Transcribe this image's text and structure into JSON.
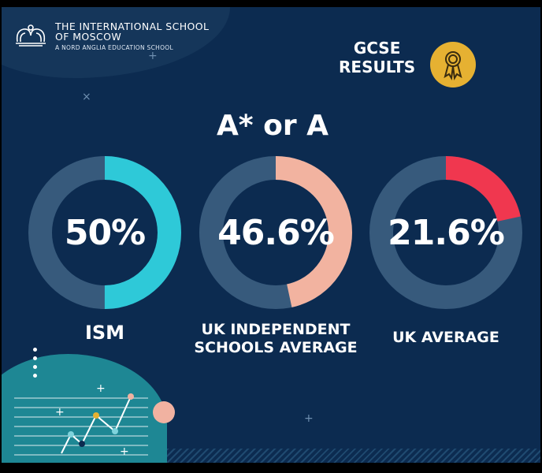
{
  "logo": {
    "line1": "THE INTERNATIONAL SCHOOL",
    "line2": "OF MOSCOW",
    "line3": "A NORD ANGLIA EDUCATION SCHOOL"
  },
  "badge": {
    "line1": "GCSE",
    "line2": "RESULTS",
    "icon": "award-ribbon-icon"
  },
  "colors": {
    "background": "#0c2b50",
    "track": "#375a7c",
    "ism": "#2ec9d8",
    "uk_independent": "#f2b3a0",
    "uk_average": "#f0374f",
    "medal": "#e6b132"
  },
  "chart_data": {
    "type": "pie",
    "title": "A* or A",
    "series": [
      {
        "name": "ISM",
        "value": 50,
        "value_label": "50%",
        "max": 100,
        "color": "#2ec9d8",
        "label_lines": [
          "ISM"
        ]
      },
      {
        "name": "UK INDEPENDENT SCHOOLS AVERAGE",
        "value": 46.6,
        "value_label": "46.6%",
        "max": 100,
        "color": "#f2b3a0",
        "label_lines": [
          "UK INDEPENDENT",
          "SCHOOLS AVERAGE"
        ]
      },
      {
        "name": "UK AVERAGE",
        "value": 21.6,
        "value_label": "21.6%",
        "max": 100,
        "color": "#f0374f",
        "label_lines": [
          "UK AVERAGE"
        ]
      }
    ]
  }
}
